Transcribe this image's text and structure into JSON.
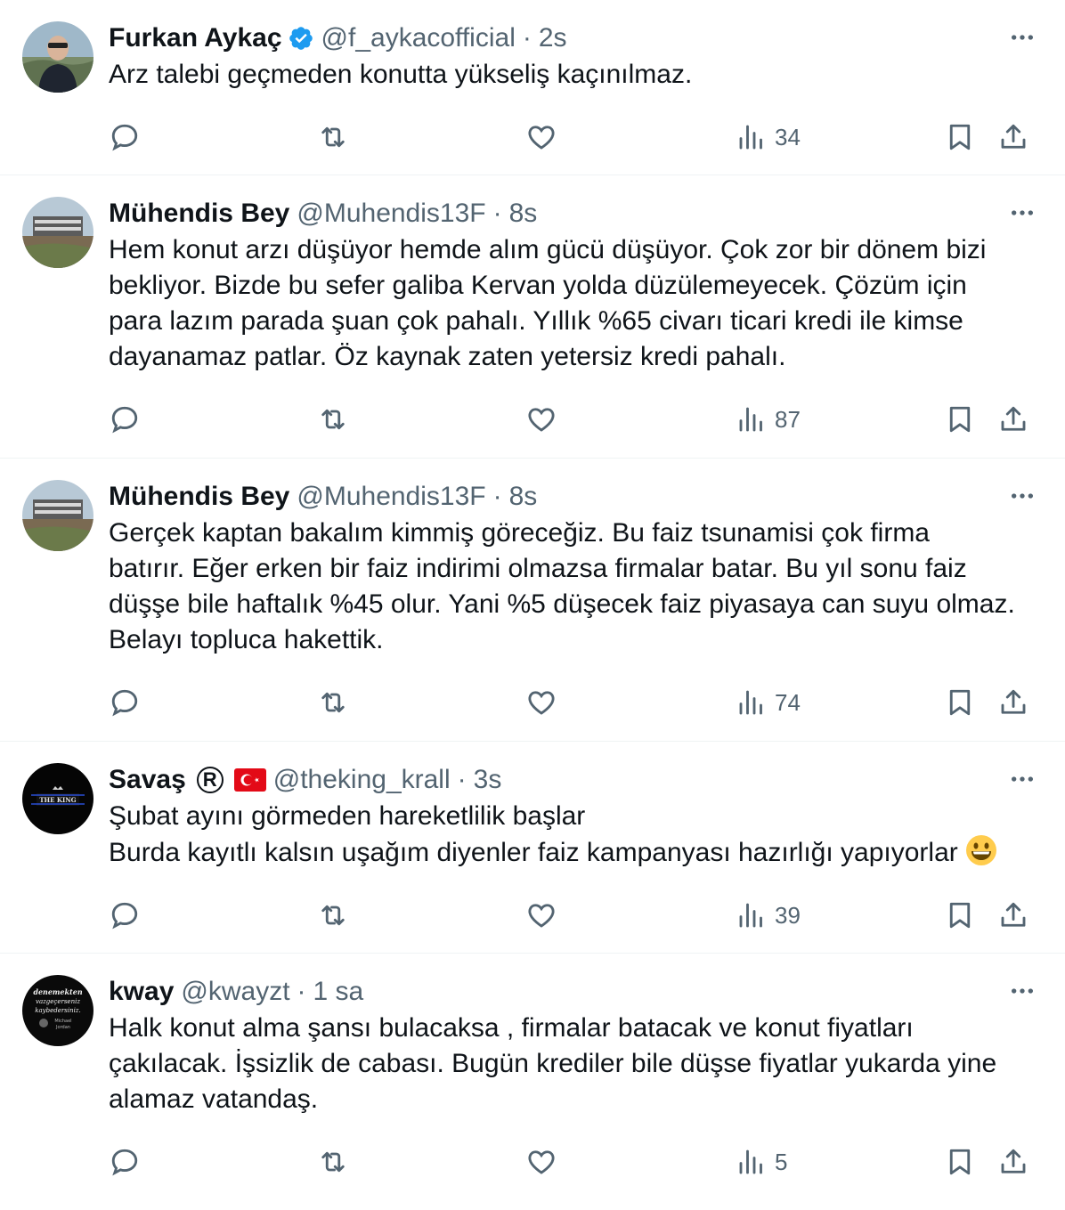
{
  "tweets": [
    {
      "name": "Furkan Aykaç",
      "handle": "@f_aykacofficial",
      "separator": "·",
      "time": "2s",
      "verified": true,
      "text": "Arz talebi geçmeden konutta yükseliş kaçınılmaz.",
      "views": "34"
    },
    {
      "name": "Mühendis Bey",
      "handle": "@Muhendis13F",
      "separator": "·",
      "time": "8s",
      "text": "Hem konut arzı düşüyor hemde alım gücü düşüyor. Çok zor bir dönem bizi\nbekliyor. Bizde bu sefer galiba Kervan yolda düzülemeyecek. Çözüm için\npara lazım parada şuan çok pahalı. Yıllık %65 civarı ticari kredi ile kimse\ndayanamaz patlar. Öz kaynak zaten yetersiz kredi pahalı.",
      "views": "87"
    },
    {
      "name": "Mühendis Bey",
      "handle": "@Muhendis13F",
      "separator": "·",
      "time": "8s",
      "text": "Gerçek kaptan bakalım kimmiş göreceğiz. Bu faiz tsunamisi çok firma\nbatırır. Eğer erken bir faiz indirimi olmazsa firmalar batar. Bu yıl sonu faiz\ndüşşe bile haftalık %45 olur. Yani %5 düşecek faiz piyasaya can suyu olmaz.\nBelayı topluca hakettik.",
      "views": "74"
    },
    {
      "name": "Savaş",
      "name_mark": "R",
      "flag": "turkey-flag",
      "handle": "@theking_krall",
      "separator": "·",
      "time": "3s",
      "text": "Şubat ayını görmeden hareketlilik başlar\nBurda kayıtlı kalsın uşağım diyenler faiz kampanyası hazırlığı yapıyorlar",
      "emoji": "grinning-face-emoji",
      "views": "39"
    },
    {
      "name": "kway",
      "handle": "@kwayzt",
      "separator": "·",
      "time": "1 sa",
      "text": "Halk konut alma şansı bulacaksa , firmalar batacak ve konut fiyatları\nçakılacak. İşsizlik de cabası.  Bugün krediler bile düşse fiyatlar yukarda yine\nalamaz vatandaş.",
      "views": "5"
    }
  ],
  "avatars": {
    "king_label": "THE KING",
    "kway_lines": [
      "denemekten",
      "vazgeçerseniz",
      "kaybedersiniz."
    ],
    "kway_caption": [
      "Michael",
      "Jordan"
    ]
  },
  "colors": {
    "text": "#0f1419",
    "secondary": "#536471",
    "verified": "#1d9bf0",
    "divider": "#eff3f4"
  }
}
